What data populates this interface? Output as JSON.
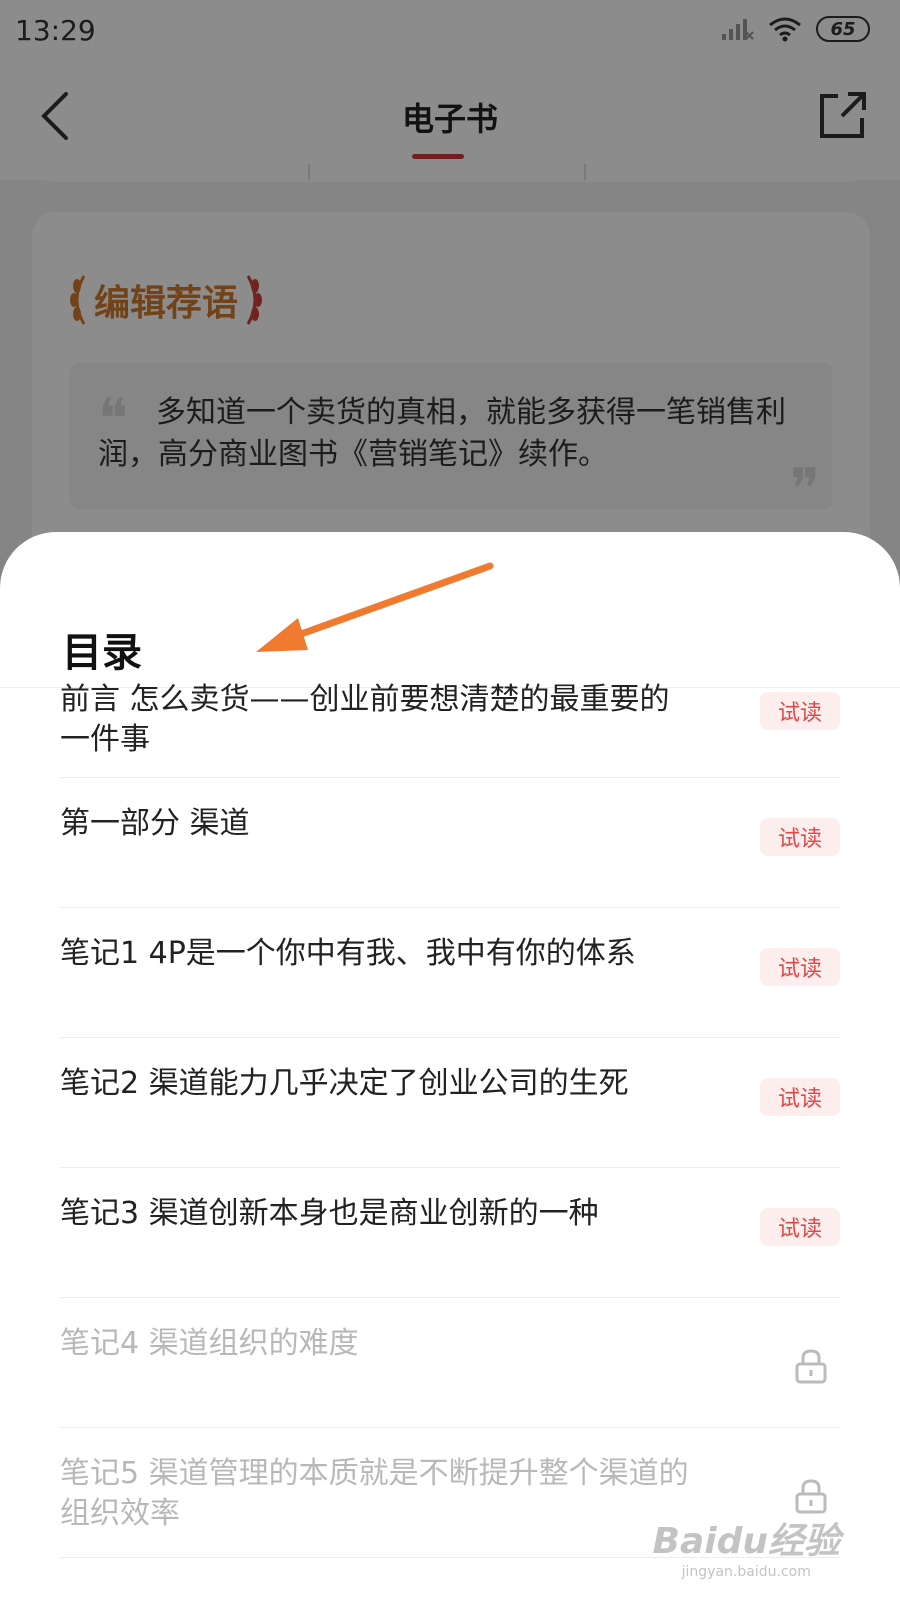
{
  "status": {
    "time": "13:29",
    "battery": "65"
  },
  "nav": {
    "title": "电子书"
  },
  "recommend": {
    "badge": "编辑荐语",
    "quote": "多知道一个卖货的真相，就能多获得一笔销售利润，高分商业图书《营销笔记》续作。"
  },
  "sheet": {
    "title": "目录",
    "items": [
      {
        "label": "前言 怎么卖货——创业前要想清楚的最重要的一件事",
        "badge": "试读"
      },
      {
        "label": "第一部分 渠道",
        "badge": "试读"
      },
      {
        "label": "笔记1 4P是一个你中有我、我中有你的体系",
        "badge": "试读"
      },
      {
        "label": "笔记2 渠道能力几乎决定了创业公司的生死",
        "badge": "试读"
      },
      {
        "label": "笔记3 渠道创新本身也是商业创新的一种",
        "badge": "试读"
      },
      {
        "label": "笔记4 渠道组织的难度",
        "locked": true
      },
      {
        "label": "笔记5 渠道管理的本质就是不断提升整个渠道的组织效率",
        "locked": true
      }
    ]
  },
  "watermark": {
    "main": "Baidu经验",
    "sub": "jingyan.baidu.com"
  },
  "colors": {
    "accent": "#d23a3a",
    "trial_bg": "#fdeeee",
    "trial_text": "#e04848",
    "arrow": "#f07a30"
  }
}
